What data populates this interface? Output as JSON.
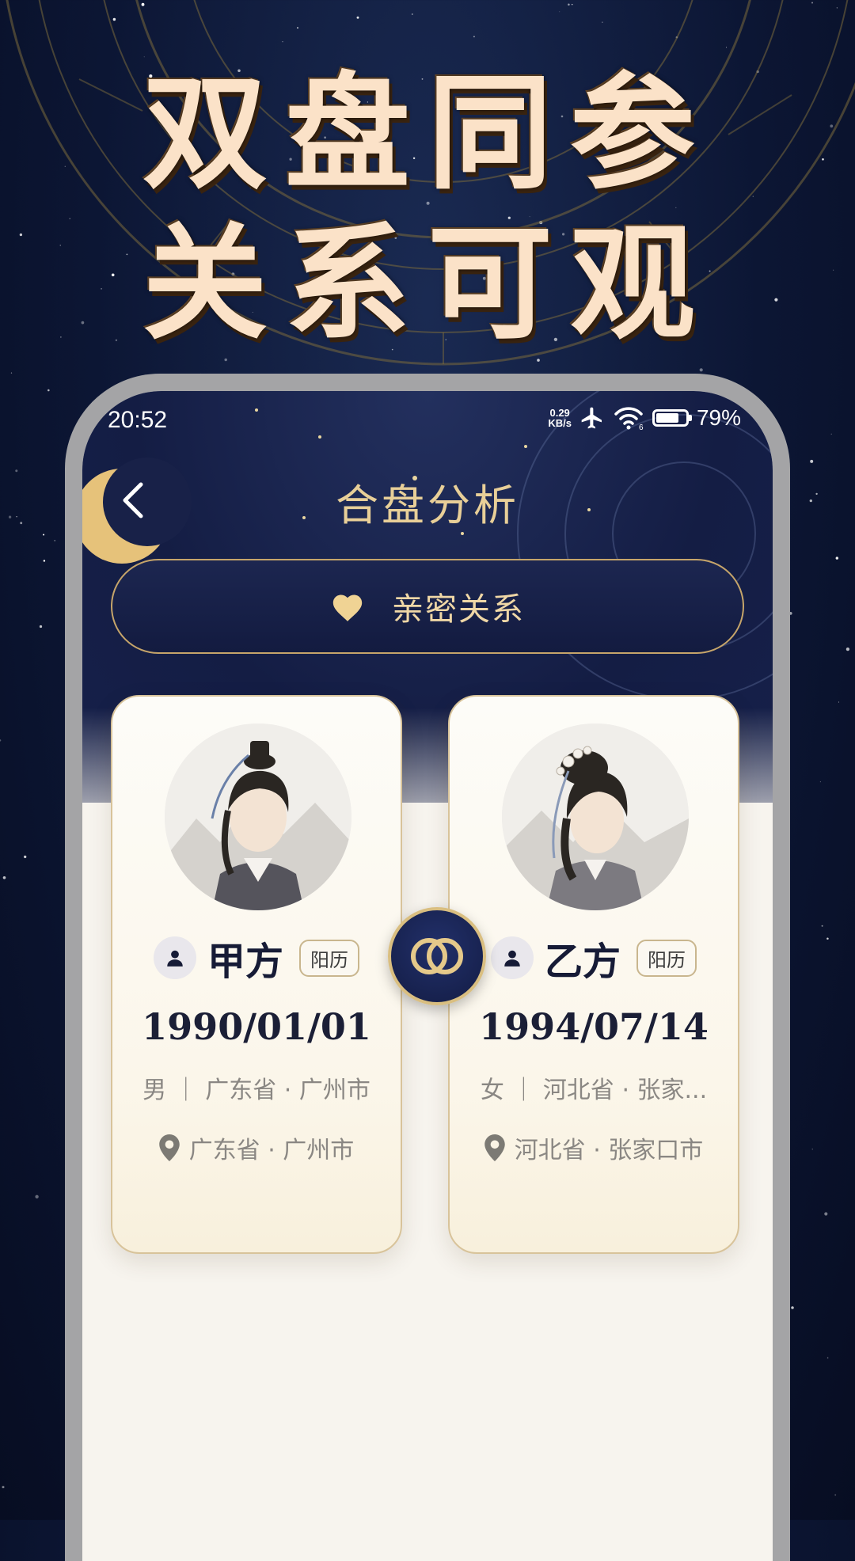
{
  "headline": {
    "line1": "双盘同参",
    "line2": "关系可观"
  },
  "status_bar": {
    "time": "20:52",
    "net_speed_value": "0.29",
    "net_speed_unit": "KB/s",
    "wifi_label": "6",
    "battery_level": 0.79,
    "battery_text": "79%"
  },
  "header": {
    "title": "合盘分析"
  },
  "relation": {
    "label": "亲密关系",
    "icon": "heart-icon"
  },
  "persons": [
    {
      "name": "甲方",
      "calendar": "阳历",
      "birth_date": "1990/01/01",
      "gender": "男",
      "birthplace_short": "男 ｜ 广东省 · 广州市",
      "location": "广东省 · 广州市",
      "avatar": "male-portrait"
    },
    {
      "name": "乙方",
      "calendar": "阳历",
      "birth_date": "1994/07/14",
      "gender": "女",
      "birthplace_short": "女 ｜ 河北省 · 张家...",
      "location": "河北省 · 张家口市",
      "avatar": "female-portrait"
    }
  ],
  "colors": {
    "gold": "#d9be80",
    "navy": "#141d44",
    "cream": "#fbf6ea"
  }
}
